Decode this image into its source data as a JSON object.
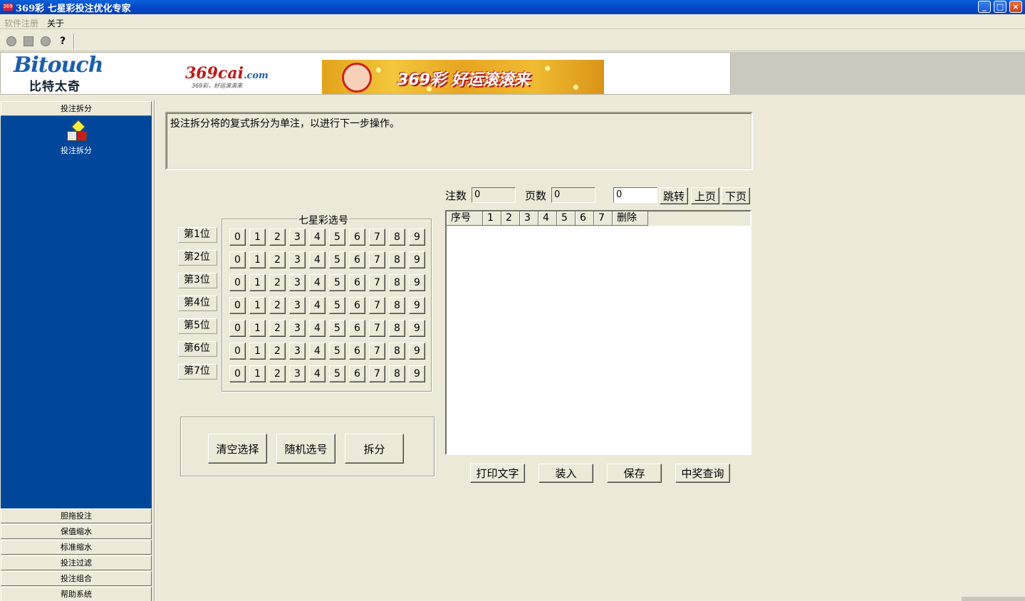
{
  "window": {
    "title": "369彩 七星彩投注优化专家",
    "icon_text": "369",
    "buttons": {
      "minimize": "_",
      "maximize": "□",
      "close": "×"
    }
  },
  "menu": [
    {
      "label": "软件注册",
      "enabled": false
    },
    {
      "label": "关于",
      "enabled": true
    }
  ],
  "toolbar": {
    "icons": [
      "record-icon",
      "save-icon",
      "print-icon",
      "help-icon"
    ],
    "help_glyph": "?"
  },
  "banner": {
    "brand_en": "Bitouch",
    "brand_cn": "比特太奇",
    "site_logo_main": "369cai",
    "site_logo_tld": ".com",
    "site_logo_slogan": "369彩，好运滚滚来",
    "ad_text": "369彩  好运滚滚来"
  },
  "sidebar": {
    "active_section": "投注拆分",
    "active_item_label": "投注拆分",
    "sections": [
      "胆拖投注",
      "保值缩水",
      "标准缩水",
      "投注过滤",
      "投注组合",
      "帮助系统"
    ]
  },
  "description": "投注拆分将的复式拆分为单注，以进行下一步操作。",
  "picker": {
    "group_title": "七星彩选号",
    "positions": [
      "第1位",
      "第2位",
      "第3位",
      "第4位",
      "第5位",
      "第6位",
      "第7位"
    ],
    "digits": [
      "0",
      "1",
      "2",
      "3",
      "4",
      "5",
      "6",
      "7",
      "8",
      "9"
    ]
  },
  "actions": {
    "clear": "清空选择",
    "random": "随机选号",
    "split": "拆分"
  },
  "results": {
    "bets_label": "注数",
    "bets_value": "0",
    "pages_label": "页数",
    "pages_value": "0",
    "jump_value": "0",
    "jump_button": "跳转",
    "prev_button": "上页",
    "next_button": "下页",
    "columns": [
      "序号",
      "1",
      "2",
      "3",
      "4",
      "5",
      "6",
      "7",
      "删除"
    ],
    "rows": []
  },
  "bottom_buttons": {
    "print": "打印文字",
    "load": "装入",
    "save": "保存",
    "prize_check": "中奖查询"
  }
}
